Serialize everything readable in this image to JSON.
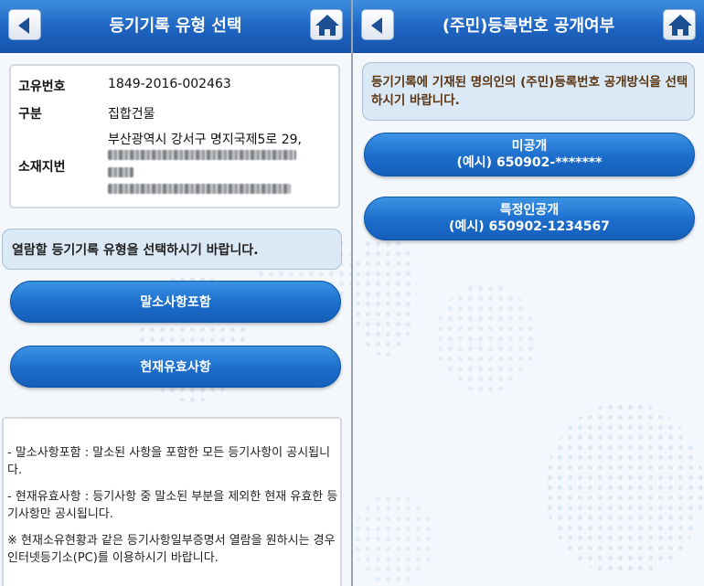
{
  "left_screen": {
    "title": "등기기록 유형 선택",
    "info": {
      "unique_no_label": "고유번호",
      "unique_no_value": "1849-2016-002463",
      "category_label": "구분",
      "category_value": "집합건물",
      "address_label": "소재지번",
      "address_line1": "부산광역시 강서구 명지국제5로 29,"
    },
    "instruction": "열람할 등기기록 유형을 선택하시기 바랍니다.",
    "buttons": {
      "include_cancelled": "말소사항포함",
      "current_valid": "현재유효사항"
    },
    "notes": {
      "note1": "- 말소사항포함 : 말소된 사항을 포함한 모든 등기사항이 공시됩니다.",
      "note2": "- 현재유효사항 : 등기사항 중 말소된 부분을 제외한 현재 유효한 등기사항만 공시됩니다.",
      "note3": "※ 현재소유현황과 같은 등기사항일부증명서 열람을 원하시는 경우 인터넷등기소(PC)를 이용하시기 바랍니다."
    }
  },
  "right_screen": {
    "title": "(주민)등록번호 공개여부",
    "instruction": "등기기록에 기재된 명의인의 (주민)등록번호 공개방식을 선택하시기 바랍니다.",
    "options": {
      "private_label": "미공개",
      "private_example": "(예시) 650902-*******",
      "specific_label": "특정인공개",
      "specific_example": "(예시) 650902-1234567"
    }
  },
  "icons": {
    "back": "back-arrow-icon",
    "home": "home-icon"
  },
  "colors": {
    "titlebar": "#1d63c0",
    "button": "#1c6dcc",
    "notice_bg": "#dbe8f5",
    "instruction_text_right": "#5a3510"
  }
}
